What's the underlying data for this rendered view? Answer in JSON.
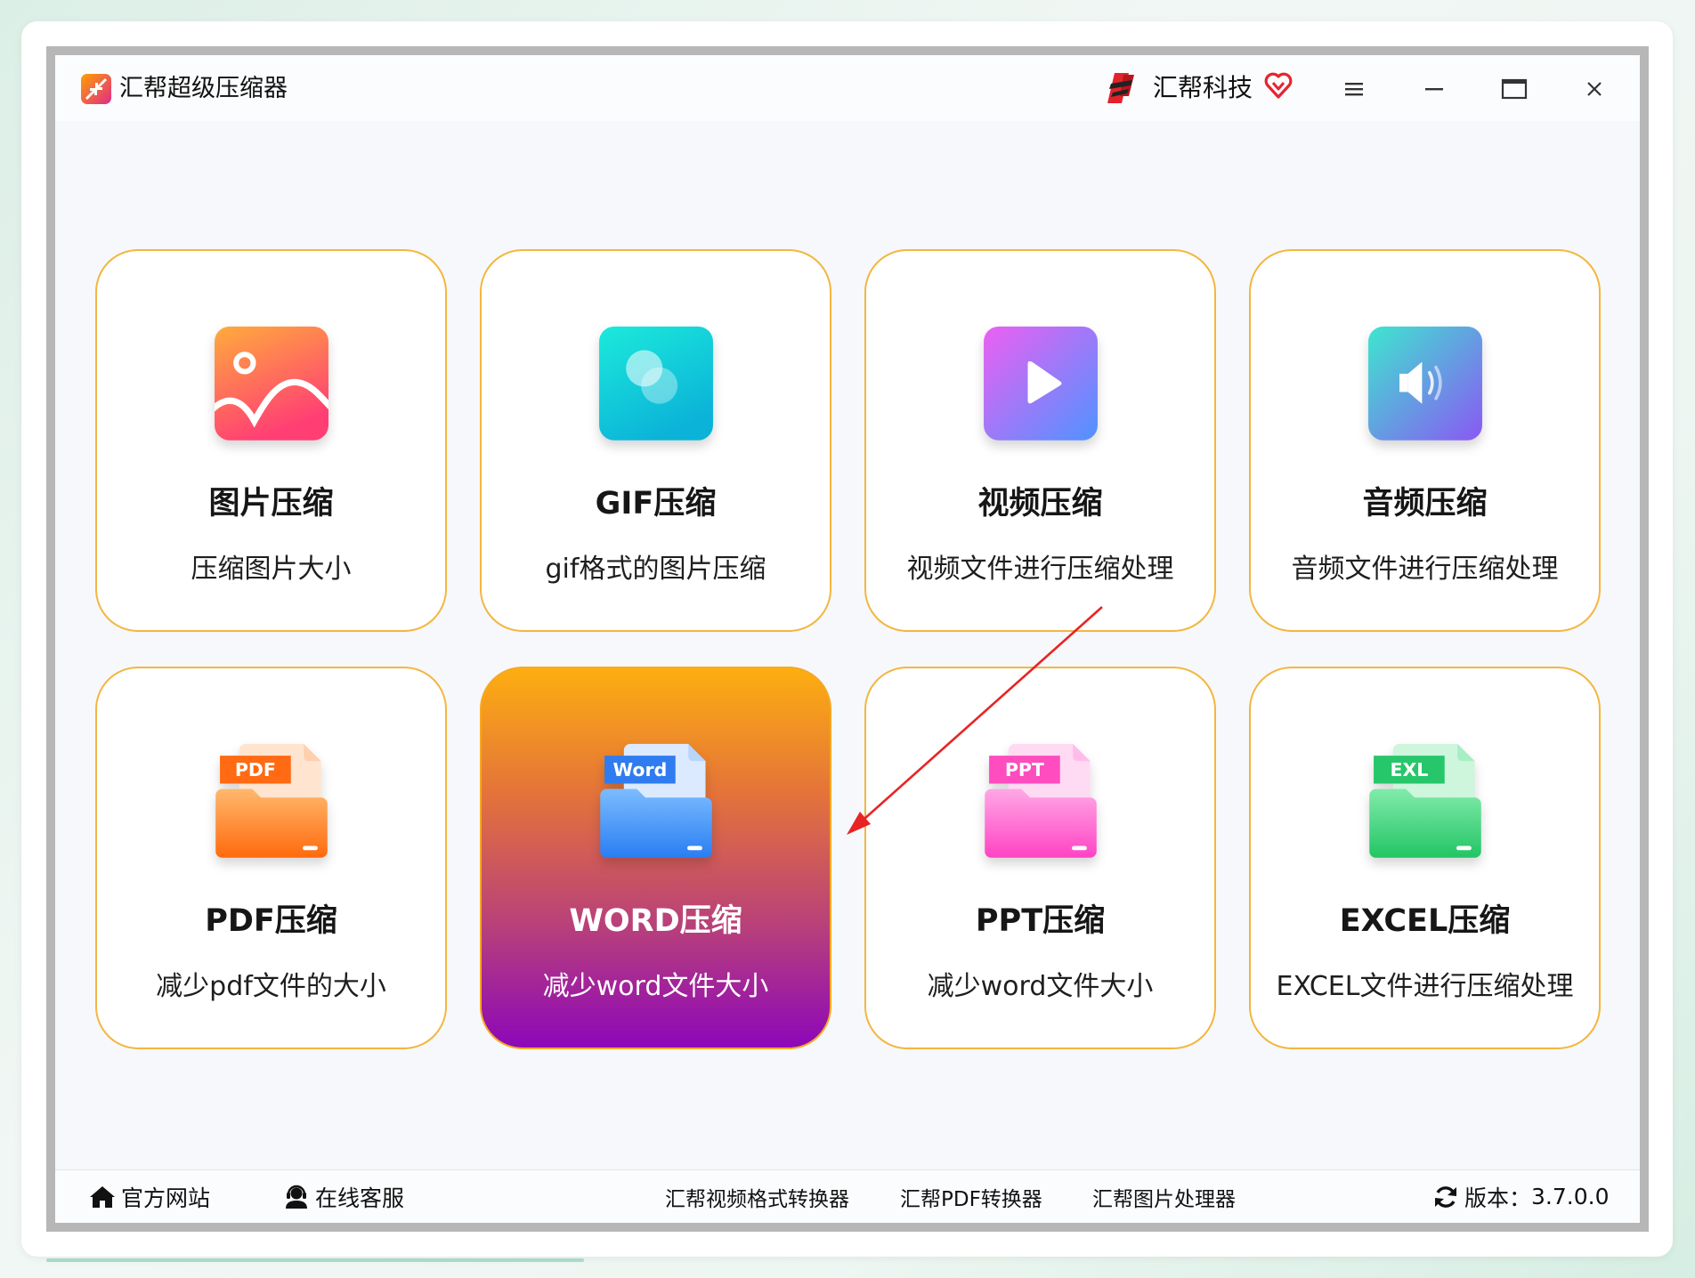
{
  "window": {
    "title": "汇帮超级压缩器",
    "brand": "汇帮科技",
    "logo_icon": "app-logo-icon",
    "brand_icon": "brand-logo-icon",
    "controls": [
      "menu-icon",
      "minimize-icon",
      "maximize-icon",
      "close-icon"
    ]
  },
  "tools": [
    {
      "title": "图片压缩",
      "desc": "压缩图片大小",
      "icon": "image-icon",
      "selected": false
    },
    {
      "title": "GIF压缩",
      "desc": "gif格式的图片压缩",
      "icon": "gif-icon",
      "selected": false
    },
    {
      "title": "视频压缩",
      "desc": "视频文件进行压缩处理",
      "icon": "video-icon",
      "selected": false
    },
    {
      "title": "音频压缩",
      "desc": "音频文件进行压缩处理",
      "icon": "audio-icon",
      "selected": false
    },
    {
      "title": "PDF压缩",
      "desc": "减少pdf文件的大小",
      "icon": "pdf-folder-icon",
      "badge": "PDF",
      "selected": false
    },
    {
      "title": "WORD压缩",
      "desc": "减少word文件大小",
      "icon": "word-folder-icon",
      "badge": "Word",
      "selected": true
    },
    {
      "title": "PPT压缩",
      "desc": "减少word文件大小",
      "icon": "ppt-folder-icon",
      "badge": "PPT",
      "selected": false
    },
    {
      "title": "EXCEL压缩",
      "desc": "EXCEL文件进行压缩处理",
      "icon": "excel-folder-icon",
      "badge": "EXL",
      "selected": false
    }
  ],
  "footer": {
    "website": "官方网站",
    "support": "在线客服",
    "links": [
      "汇帮视频格式转换器",
      "汇帮PDF转换器",
      "汇帮图片处理器"
    ],
    "version_label": "版本：",
    "version": "3.7.0.0"
  },
  "colors": {
    "card_border": "#f4b63f",
    "selected_top": "#fdae10",
    "selected_bottom": "#8d07b9",
    "content_bg": "#f6f8fb",
    "annotation_arrow": "#e82424"
  }
}
